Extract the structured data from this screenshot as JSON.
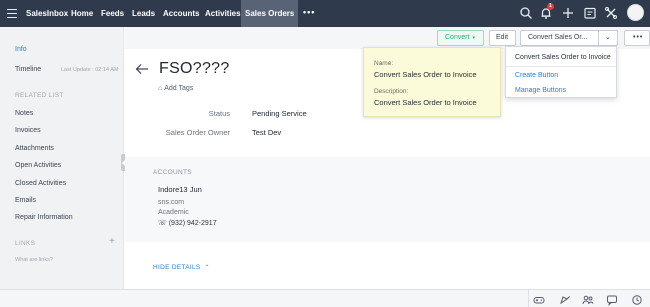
{
  "topnav": {
    "items": [
      "SalesInbox",
      "Home",
      "Feeds",
      "Leads",
      "Accounts",
      "Activities",
      "Sales Orders"
    ],
    "active": "Sales Orders",
    "more": "•••",
    "notification_count": "1"
  },
  "sidebar": {
    "info": "Info",
    "timeline": "Timeline",
    "last_update": "Last Update : 02:14 AM",
    "related_list_heading": "RELATED LIST",
    "related_items": [
      "Notes",
      "Invoices",
      "Attachments",
      "Open Activities",
      "Closed Activities",
      "Emails",
      "Repair Information"
    ],
    "links_heading": "LINKS",
    "links_help": "What are links?"
  },
  "actions": {
    "convert_label": "Convert",
    "edit_label": "Edit",
    "custom_button_label": "Convert Sales Or...",
    "more_label": "•••"
  },
  "record": {
    "title": "FSO????",
    "add_tags": "Add Tags",
    "fields": [
      {
        "label": "Status",
        "value": "Pending Service"
      },
      {
        "label": "Sales Order Owner",
        "value": "Test Dev"
      }
    ]
  },
  "accounts": {
    "heading": "ACCOUNTS",
    "name": "Indore13 Jun",
    "website": "sns.com",
    "type": "Academic",
    "phone": "(932) 942-2917"
  },
  "hide_details": "HIDE DETAILS",
  "tooltip": {
    "name_label": "Name:",
    "name_value": "Convert Sales Order to Invoice",
    "description_label": "Description:",
    "description_value": "Convert Sales Order to Invoice"
  },
  "dropdown": {
    "items": [
      "Convert Sales Order to Invoice",
      "Create Button",
      "Manage Buttons"
    ]
  },
  "colors": {
    "topbar": "#2f3a4c",
    "active_tab": "#586476",
    "link_blue": "#2b7de1",
    "convert_green": "#2fae78",
    "tooltip_bg": "#fbfbd9"
  }
}
